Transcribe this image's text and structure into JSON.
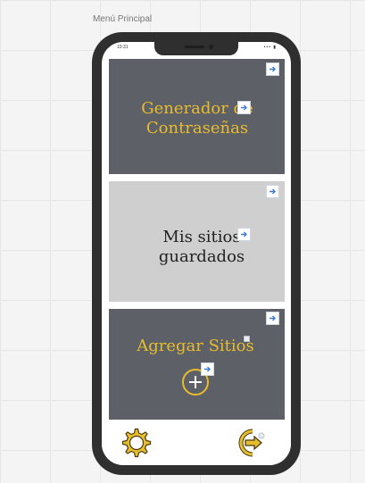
{
  "frame": {
    "label": "Menú Principal"
  },
  "status_bar": {
    "time": "10:31",
    "icons": "••• ▮"
  },
  "cards": {
    "generator": {
      "title_line1": "Generador de",
      "title_line2": "Contraseñas",
      "icon": "arrow-right-icon"
    },
    "saved_sites": {
      "title_line1": "Mis sitios",
      "title_line2": "guardados",
      "icon": "arrow-right-icon"
    },
    "add_sites": {
      "title": "Agregar Sitios",
      "icon": "plus-circle-icon"
    }
  },
  "bottom_bar": {
    "settings_icon": "gear-icon",
    "logout_icon": "logout-icon"
  },
  "colors": {
    "accent": "#e7bc2e",
    "card_dark": "#5e6068",
    "card_light": "#cfcfcf",
    "link_arrow": "#3b7ddd",
    "phone_frame": "#2f2f2f"
  }
}
